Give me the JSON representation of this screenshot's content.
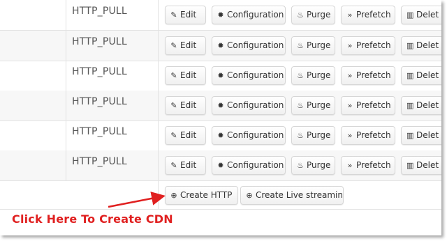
{
  "rows": [
    {
      "type": "HTTP_PULL"
    },
    {
      "type": "HTTP_PULL"
    },
    {
      "type": "HTTP_PULL"
    },
    {
      "type": "HTTP_PULL"
    },
    {
      "type": "HTTP_PULL"
    },
    {
      "type": "HTTP_PULL"
    }
  ],
  "actions": {
    "edit": "Edit",
    "configuration": "Configuration",
    "purge": "Purge",
    "prefetch": "Prefetch",
    "delete": "Delet"
  },
  "create": {
    "http": "Create HTTP",
    "live": "Create Live streaming"
  },
  "annotation": {
    "text": "Click Here To Create CDN",
    "color": "#e02020"
  },
  "icons": {
    "edit": "pencil-icon",
    "configuration": "gear-icon",
    "purge": "fire-icon",
    "prefetch": "fast-forward-icon",
    "delete": "trash-icon",
    "create": "plus-circle-icon"
  }
}
